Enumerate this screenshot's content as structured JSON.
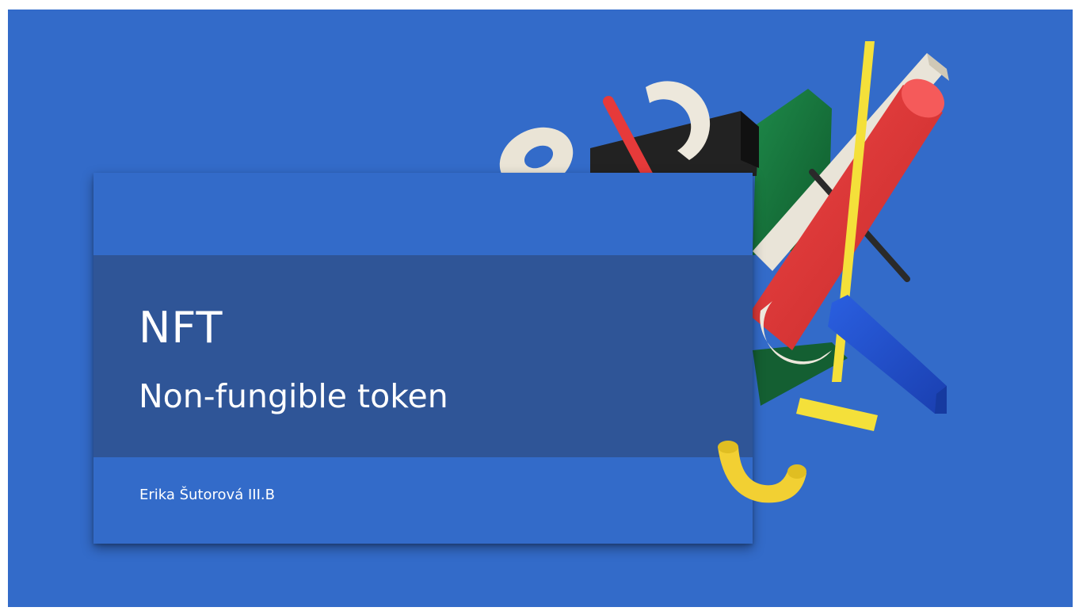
{
  "slide": {
    "title": "NFT",
    "subtitle": "Non-fungible token",
    "author": "Erika Šutorová III.B"
  },
  "colors": {
    "background": "#336BC9",
    "band": "#2F5597",
    "text": "#FFFFFF"
  },
  "decorations": [
    "torus-shape",
    "ring-shape",
    "black-block",
    "green-block",
    "beige-bar",
    "yellow-bar",
    "red-cylinder",
    "blue-bar",
    "small-yellow-bar",
    "yellow-hook",
    "ring-arc"
  ]
}
